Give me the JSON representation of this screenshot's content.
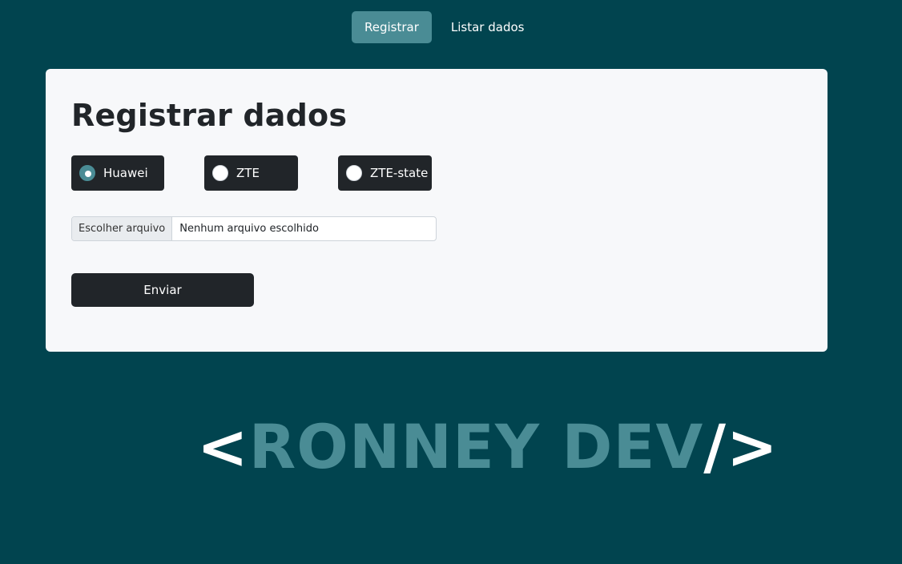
{
  "nav": {
    "items": [
      {
        "label": "Registrar",
        "active": true
      },
      {
        "label": "Listar dados",
        "active": false
      }
    ]
  },
  "form": {
    "title": "Registrar dados",
    "radios": [
      {
        "label": "Huawei",
        "checked": true
      },
      {
        "label": "ZTE",
        "checked": false
      },
      {
        "label": "ZTE-state",
        "checked": false
      }
    ],
    "file": {
      "button_label": "Escolher arquivo",
      "status_text": "Nenhum arquivo escolhido"
    },
    "submit_label": "Enviar"
  },
  "logo": {
    "open": "<",
    "name": "RONNEY DEV",
    "close": "/>"
  },
  "colors": {
    "background": "#01444f",
    "accent": "#4a8c95",
    "dark": "#212529",
    "card": "#f7f8fa"
  }
}
